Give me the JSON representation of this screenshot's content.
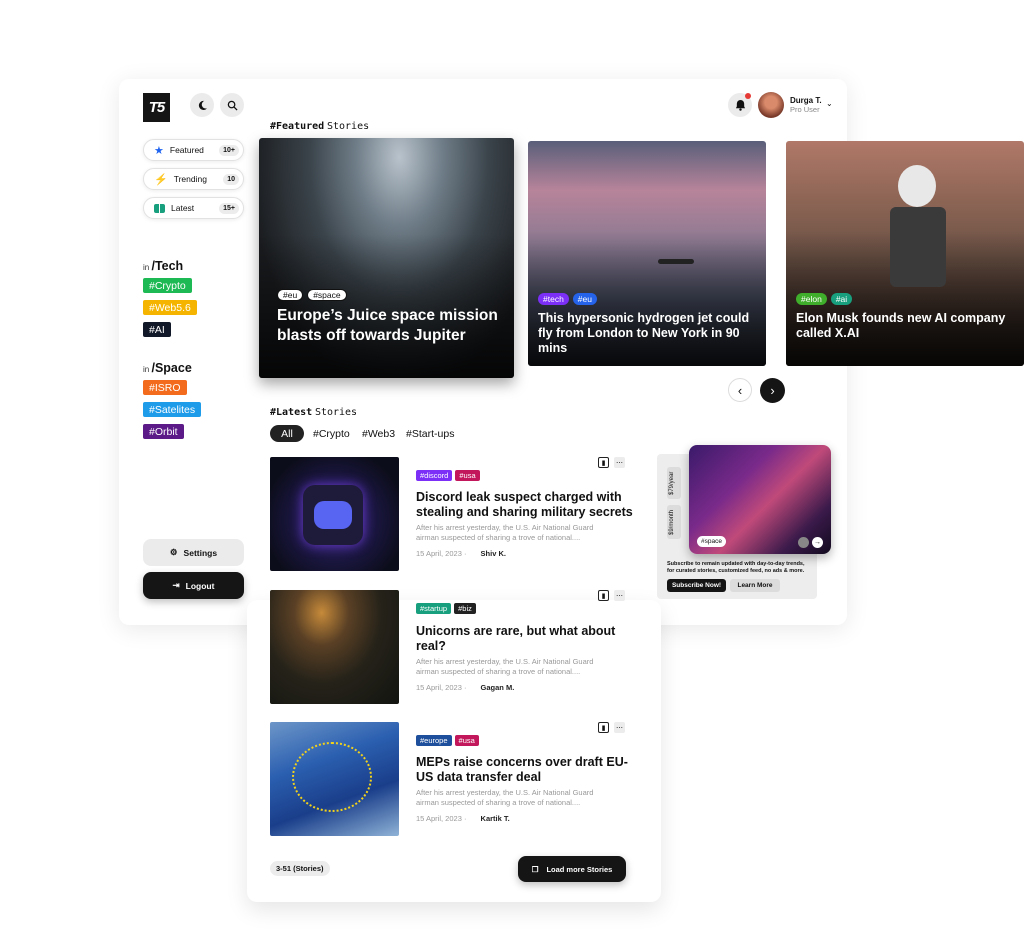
{
  "header": {
    "logo": "T5",
    "user_name": "Durga T.",
    "user_role": "Pro User"
  },
  "nav": [
    {
      "label": "Featured",
      "count": "10+"
    },
    {
      "label": "Trending",
      "count": "10"
    },
    {
      "label": "Latest",
      "count": "15+"
    }
  ],
  "tech": {
    "prefix": "in",
    "title": "/Tech",
    "tags": [
      "#Crypto",
      "#Web5.6",
      "#AI"
    ]
  },
  "space": {
    "prefix": "in",
    "title": "/Space",
    "tags": [
      "#ISRO",
      "#Satelites",
      "#Orbit"
    ]
  },
  "settings_label": "Settings",
  "logout_label": "Logout",
  "featured": {
    "title_bold": "#Featured",
    "title_rest": "Stories",
    "cards": [
      {
        "tags": [
          "#eu",
          "#space"
        ],
        "title": "Europe’s Juice space mission blasts off towards Jupiter"
      },
      {
        "tags": [
          "#tech",
          "#eu"
        ],
        "title": "This hypersonic hydrogen jet could fly from London to New York in 90 mins"
      },
      {
        "tags": [
          "#elon",
          "#ai"
        ],
        "title": "Elon Musk founds new AI company called X.AI"
      }
    ]
  },
  "latest": {
    "title_bold": "#Latest",
    "title_rest": "Stories",
    "filters": [
      "All",
      "#Crypto",
      "#Web3",
      "#Start-ups"
    ],
    "stories": [
      {
        "tags": [
          "#discord",
          "#usa"
        ],
        "title": "Discord leak suspect charged with stealing and sharing military secrets",
        "desc": "After his arrest yesterday, the U.S. Air National Guard airman suspected of sharing a trove of national....",
        "date": "15 April, 2023",
        "author": "Shiv K."
      },
      {
        "tags": [
          "#startup",
          "#biz"
        ],
        "title": "Unicorns are rare, but what about real?",
        "desc": "After his arrest yesterday, the U.S. Air National Guard airman suspected of sharing a trove of national....",
        "date": "15 April, 2023",
        "author": "Gagan M."
      },
      {
        "tags": [
          "#europe",
          "#usa"
        ],
        "title": "MEPs raise concerns over draft EU-US data transfer deal",
        "desc": "After his arrest yesterday, the U.S. Air National Guard airman suspected of sharing a trove of national....",
        "date": "15 April, 2023",
        "author": "Kartik T."
      }
    ],
    "range": "3-51 (Stories)",
    "load_more": "Load more Stories"
  },
  "promo": {
    "price_year": "$79/year",
    "price_month": "$9/month",
    "tag": "#space",
    "text": "Subscribe to remain updated with day-to-day trends, for curated stories, customized feed, no ads & more.",
    "subscribe": "Subscribe Now!",
    "learn": "Learn More"
  },
  "colors": {
    "crypto": "#1db954",
    "web": "#f4b400",
    "ai": "#111827",
    "isro": "#f36b1c",
    "satelites": "#1e9be9",
    "orbit": "#5b1a87",
    "tag_purple": "#7b2ff7",
    "tag_blue": "#2563eb",
    "tag_green": "#3fae2a",
    "tag_teal": "#18a07e",
    "tag_red": "#c2185b"
  }
}
